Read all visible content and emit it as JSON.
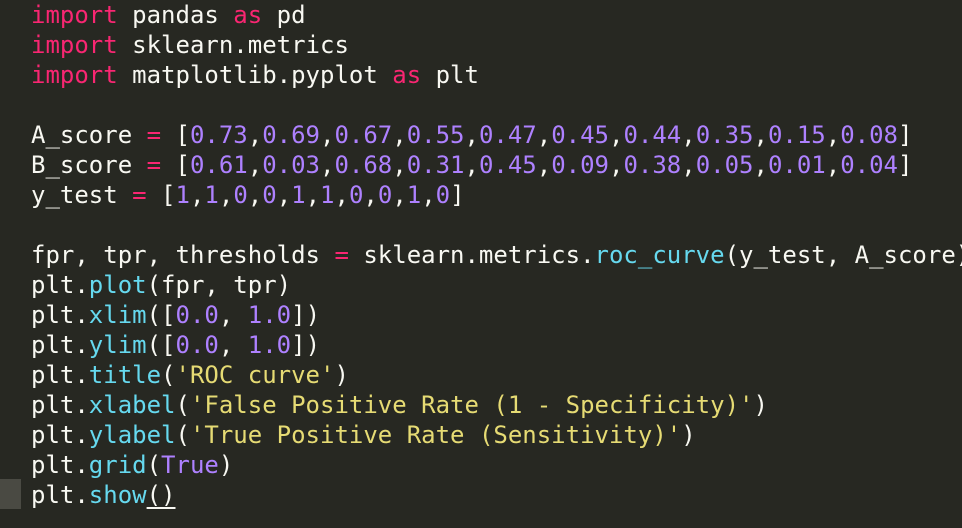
{
  "editor": {
    "lines": [
      [
        {
          "t": "kw",
          "v": "import"
        },
        {
          "t": "tx",
          "v": " pandas "
        },
        {
          "t": "kw",
          "v": "as"
        },
        {
          "t": "tx",
          "v": " pd"
        }
      ],
      [
        {
          "t": "kw",
          "v": "import"
        },
        {
          "t": "tx",
          "v": " sklearn.metrics"
        }
      ],
      [
        {
          "t": "kw",
          "v": "import"
        },
        {
          "t": "tx",
          "v": " matplotlib.pyplot "
        },
        {
          "t": "kw",
          "v": "as"
        },
        {
          "t": "tx",
          "v": " plt"
        }
      ],
      [],
      [
        {
          "t": "tx",
          "v": "A_score "
        },
        {
          "t": "op",
          "v": "="
        },
        {
          "t": "tx",
          "v": " ["
        },
        {
          "t": "num",
          "v": "0.73"
        },
        {
          "t": "tx",
          "v": ","
        },
        {
          "t": "num",
          "v": "0.69"
        },
        {
          "t": "tx",
          "v": ","
        },
        {
          "t": "num",
          "v": "0.67"
        },
        {
          "t": "tx",
          "v": ","
        },
        {
          "t": "num",
          "v": "0.55"
        },
        {
          "t": "tx",
          "v": ","
        },
        {
          "t": "num",
          "v": "0.47"
        },
        {
          "t": "tx",
          "v": ","
        },
        {
          "t": "num",
          "v": "0.45"
        },
        {
          "t": "tx",
          "v": ","
        },
        {
          "t": "num",
          "v": "0.44"
        },
        {
          "t": "tx",
          "v": ","
        },
        {
          "t": "num",
          "v": "0.35"
        },
        {
          "t": "tx",
          "v": ","
        },
        {
          "t": "num",
          "v": "0.15"
        },
        {
          "t": "tx",
          "v": ","
        },
        {
          "t": "num",
          "v": "0.08"
        },
        {
          "t": "tx",
          "v": "]"
        }
      ],
      [
        {
          "t": "tx",
          "v": "B_score "
        },
        {
          "t": "op",
          "v": "="
        },
        {
          "t": "tx",
          "v": " ["
        },
        {
          "t": "num",
          "v": "0.61"
        },
        {
          "t": "tx",
          "v": ","
        },
        {
          "t": "num",
          "v": "0.03"
        },
        {
          "t": "tx",
          "v": ","
        },
        {
          "t": "num",
          "v": "0.68"
        },
        {
          "t": "tx",
          "v": ","
        },
        {
          "t": "num",
          "v": "0.31"
        },
        {
          "t": "tx",
          "v": ","
        },
        {
          "t": "num",
          "v": "0.45"
        },
        {
          "t": "tx",
          "v": ","
        },
        {
          "t": "num",
          "v": "0.09"
        },
        {
          "t": "tx",
          "v": ","
        },
        {
          "t": "num",
          "v": "0.38"
        },
        {
          "t": "tx",
          "v": ","
        },
        {
          "t": "num",
          "v": "0.05"
        },
        {
          "t": "tx",
          "v": ","
        },
        {
          "t": "num",
          "v": "0.01"
        },
        {
          "t": "tx",
          "v": ","
        },
        {
          "t": "num",
          "v": "0.04"
        },
        {
          "t": "tx",
          "v": "]"
        }
      ],
      [
        {
          "t": "tx",
          "v": "y_test "
        },
        {
          "t": "op",
          "v": "="
        },
        {
          "t": "tx",
          "v": " ["
        },
        {
          "t": "num",
          "v": "1"
        },
        {
          "t": "tx",
          "v": ","
        },
        {
          "t": "num",
          "v": "1"
        },
        {
          "t": "tx",
          "v": ","
        },
        {
          "t": "num",
          "v": "0"
        },
        {
          "t": "tx",
          "v": ","
        },
        {
          "t": "num",
          "v": "0"
        },
        {
          "t": "tx",
          "v": ","
        },
        {
          "t": "num",
          "v": "1"
        },
        {
          "t": "tx",
          "v": ","
        },
        {
          "t": "num",
          "v": "1"
        },
        {
          "t": "tx",
          "v": ","
        },
        {
          "t": "num",
          "v": "0"
        },
        {
          "t": "tx",
          "v": ","
        },
        {
          "t": "num",
          "v": "0"
        },
        {
          "t": "tx",
          "v": ","
        },
        {
          "t": "num",
          "v": "1"
        },
        {
          "t": "tx",
          "v": ","
        },
        {
          "t": "num",
          "v": "0"
        },
        {
          "t": "tx",
          "v": "]"
        }
      ],
      [],
      [
        {
          "t": "tx",
          "v": "fpr, tpr, thresholds "
        },
        {
          "t": "op",
          "v": "="
        },
        {
          "t": "tx",
          "v": " sklearn.metrics."
        },
        {
          "t": "fn",
          "v": "roc_curve"
        },
        {
          "t": "tx",
          "v": "(y_test, A_score)"
        }
      ],
      [
        {
          "t": "tx",
          "v": "plt."
        },
        {
          "t": "fn",
          "v": "plot"
        },
        {
          "t": "tx",
          "v": "(fpr, tpr)"
        }
      ],
      [
        {
          "t": "tx",
          "v": "plt."
        },
        {
          "t": "fn",
          "v": "xlim"
        },
        {
          "t": "tx",
          "v": "(["
        },
        {
          "t": "num",
          "v": "0.0"
        },
        {
          "t": "tx",
          "v": ", "
        },
        {
          "t": "num",
          "v": "1.0"
        },
        {
          "t": "tx",
          "v": "])"
        }
      ],
      [
        {
          "t": "tx",
          "v": "plt."
        },
        {
          "t": "fn",
          "v": "ylim"
        },
        {
          "t": "tx",
          "v": "(["
        },
        {
          "t": "num",
          "v": "0.0"
        },
        {
          "t": "tx",
          "v": ", "
        },
        {
          "t": "num",
          "v": "1.0"
        },
        {
          "t": "tx",
          "v": "])"
        }
      ],
      [
        {
          "t": "tx",
          "v": "plt."
        },
        {
          "t": "fn",
          "v": "title"
        },
        {
          "t": "tx",
          "v": "("
        },
        {
          "t": "str",
          "v": "'ROC curve'"
        },
        {
          "t": "tx",
          "v": ")"
        }
      ],
      [
        {
          "t": "tx",
          "v": "plt."
        },
        {
          "t": "fn",
          "v": "xlabel"
        },
        {
          "t": "tx",
          "v": "("
        },
        {
          "t": "str",
          "v": "'False Positive Rate (1 - Specificity)'"
        },
        {
          "t": "tx",
          "v": ")"
        }
      ],
      [
        {
          "t": "tx",
          "v": "plt."
        },
        {
          "t": "fn",
          "v": "ylabel"
        },
        {
          "t": "tx",
          "v": "("
        },
        {
          "t": "str",
          "v": "'True Positive Rate (Sensitivity)'"
        },
        {
          "t": "tx",
          "v": ")"
        }
      ],
      [
        {
          "t": "tx",
          "v": "plt."
        },
        {
          "t": "fn",
          "v": "grid"
        },
        {
          "t": "tx",
          "v": "("
        },
        {
          "t": "const",
          "v": "True"
        },
        {
          "t": "tx",
          "v": ")"
        }
      ],
      [
        {
          "t": "tx",
          "v": "plt."
        },
        {
          "t": "fn",
          "v": "show"
        },
        {
          "t": "cur",
          "v": "()"
        }
      ]
    ]
  },
  "colors": {
    "background": "#272822",
    "text": "#f8f8f2",
    "keyword": "#f92672",
    "number": "#ae81ff",
    "function": "#66d9ef",
    "string": "#e6db74"
  }
}
